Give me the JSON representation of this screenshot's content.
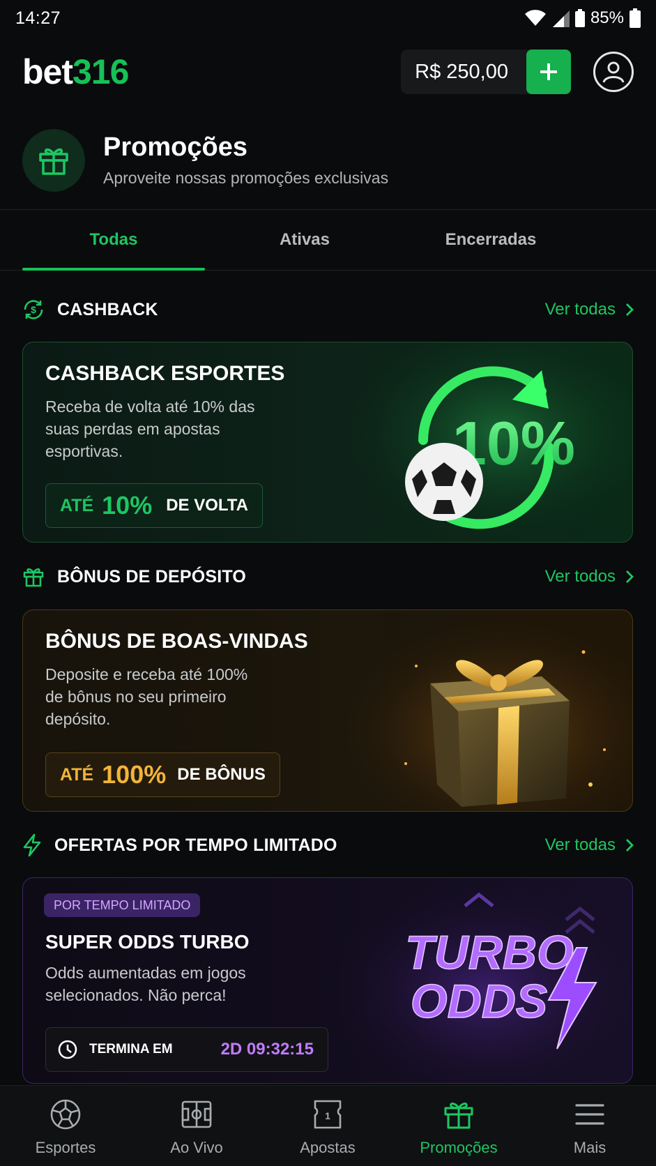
{
  "status_bar": {
    "time": "14:27",
    "battery": "85%"
  },
  "header": {
    "logo_bet": "bet",
    "logo_num": "316",
    "balance": "R$ 250,00"
  },
  "page": {
    "title": "Promoções",
    "subtitle": "Aproveite nossas promoções exclusivas"
  },
  "tabs": [
    {
      "label": "Todas",
      "active": true
    },
    {
      "label": "Ativas",
      "active": false
    },
    {
      "label": "Encerradas",
      "active": false
    }
  ],
  "sections": {
    "cashback": {
      "title": "CASHBACK",
      "see_all": "Ver todas",
      "card": {
        "title": "CASHBACK ESPORTES",
        "desc_lines": [
          "Receba de volta até 10% das",
          "suas perdas em apostas",
          "esportivas."
        ],
        "pill_prefix": "ATÉ",
        "pill_value": "10%",
        "pill_suffix": "DE VOLTA",
        "art_text": "10%"
      }
    },
    "deposit": {
      "title": "BÔNUS DE DEPÓSITO",
      "see_all": "Ver todos",
      "card": {
        "title": "BÔNUS DE BOAS-VINDAS",
        "desc_lines": [
          "Deposite e receba até 100%",
          "de bônus no seu primeiro",
          "depósito."
        ],
        "pill_prefix": "ATÉ",
        "pill_value": "100%",
        "pill_suffix": "DE BÔNUS"
      }
    },
    "limited": {
      "title": "OFERTAS POR TEMPO LIMITADO",
      "see_all": "Ver todas",
      "card": {
        "badge": "POR TEMPO LIMITADO",
        "title": "SUPER ODDS TURBO",
        "desc_lines": [
          "Odds aumentadas em jogos",
          "selecionados. Não perca!"
        ],
        "timer_label": "TERMINA EM",
        "timer_value": "2D 09:32:15",
        "art_line1": "TURBO",
        "art_line2": "ODDS"
      }
    }
  },
  "bottom_nav": [
    {
      "label": "Esportes",
      "icon": "soccer-ball-icon",
      "active": false
    },
    {
      "label": "Ao Vivo",
      "icon": "live-screen-icon",
      "active": false
    },
    {
      "label": "Apostas",
      "icon": "ticket-icon",
      "active": false
    },
    {
      "label": "Promoções",
      "icon": "gift-icon",
      "active": true
    },
    {
      "label": "Mais",
      "icon": "menu-icon",
      "active": false
    }
  ],
  "colors": {
    "accent": "#16c157",
    "gold": "#f2b43a",
    "purple": "#b26cff",
    "background": "#0a0b0c"
  }
}
